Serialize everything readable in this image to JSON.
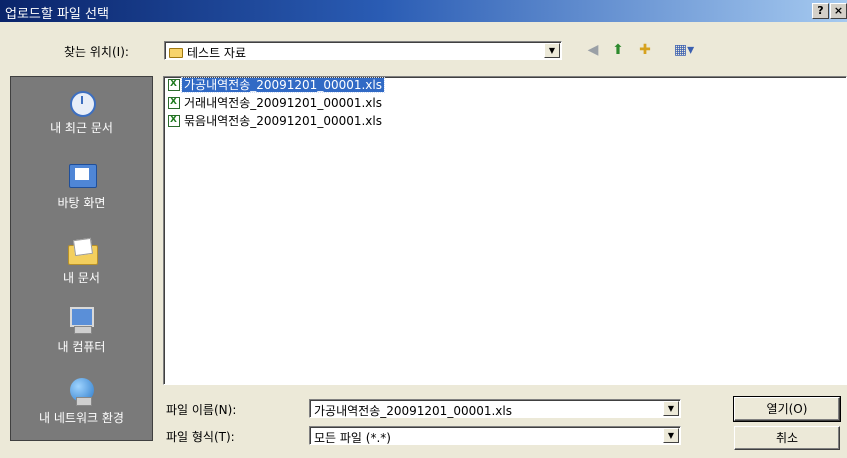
{
  "window": {
    "title": "업로드할 파일 선택",
    "help_button": "?",
    "close_button": "×"
  },
  "toolbar": {
    "lookin_label": "찾는 위치(I):",
    "lookin_value": "테스트 자료",
    "icons": [
      "back-icon",
      "up-folder-icon",
      "new-folder-icon",
      "view-menu-icon"
    ]
  },
  "places": [
    {
      "label": "내 최근 문서",
      "icon": "recent-documents-icon"
    },
    {
      "label": "바탕 화면",
      "icon": "desktop-icon"
    },
    {
      "label": "내 문서",
      "icon": "my-documents-icon"
    },
    {
      "label": "내 컴퓨터",
      "icon": "my-computer-icon"
    },
    {
      "label": "내 네트워크 환경",
      "icon": "network-icon"
    }
  ],
  "files": [
    {
      "name": "가공내역전송_20091201_00001.xls",
      "selected": true
    },
    {
      "name": "거래내역전송_20091201_00001.xls",
      "selected": false
    },
    {
      "name": "묶음내역전송_20091201_00001.xls",
      "selected": false
    }
  ],
  "filename": {
    "label": "파일 이름(N):",
    "value": "가공내역전송_20091201_00001.xls"
  },
  "filetype": {
    "label": "파일 형식(T):",
    "value": "모든 파일 (*.*)"
  },
  "buttons": {
    "open": "열기(O)",
    "cancel": "취소"
  }
}
